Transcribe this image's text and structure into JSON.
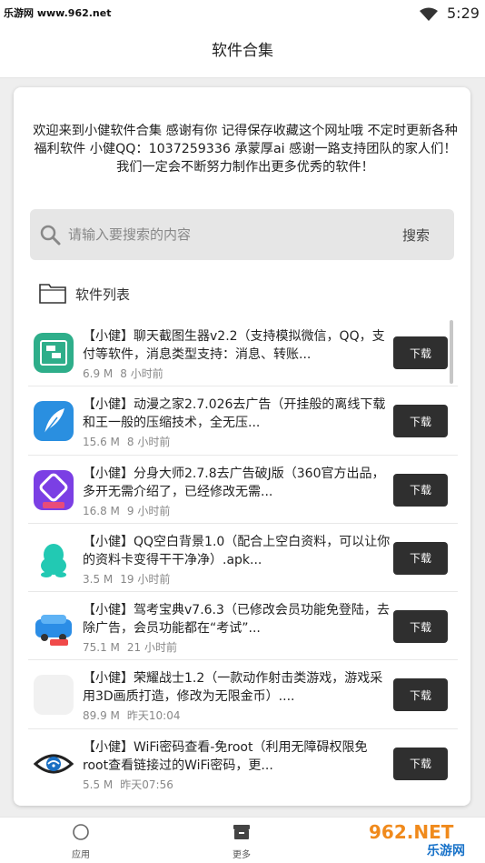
{
  "status_bar": {
    "watermark": "乐游网 www.962.net",
    "time": "5:29"
  },
  "header": {
    "title": "软件合集"
  },
  "intro": {
    "text": "欢迎来到小健软件合集 感谢有你 记得保存收藏这个网址哦 不定时更新各种福利软件 小健QQ：1037259336 承蒙厚ai 感谢一路支持团队的家人们！我们一定会不断努力制作出更多优秀的软件！"
  },
  "search": {
    "placeholder": "请输入要搜索的内容",
    "value": "",
    "button_label": "搜索"
  },
  "section": {
    "label": "软件列表",
    "icon": "folder-icon"
  },
  "apps": [
    {
      "title": "【小健】聊天截图生器v2.2（支持模拟微信，QQ，支付等软件，消息类型支持：消息、转账...",
      "size": "6.9 M",
      "time": "8 小时前",
      "button": "下载",
      "icon": "chat-screenshot-icon",
      "color": "#2eae8a"
    },
    {
      "title": "【小健】动漫之家2.7.026去广告（开挂般的离线下载和王一般的压缩技术，全无压...",
      "size": "15.6 M",
      "time": "8 小时前",
      "button": "下载",
      "icon": "feather-icon",
      "color": "#2a8fe0"
    },
    {
      "title": "【小健】分身大师2.7.8去广告破J版（360官方出品，多开无需介绍了，已经修改无需...",
      "size": "16.8 M",
      "time": "9 小时前",
      "button": "下载",
      "icon": "clone-master-icon",
      "color": "#7b3fe4"
    },
    {
      "title": "【小健】QQ空白背景1.0（配合上空白资料，可以让你的资料卡变得干干净净）.apk...",
      "size": "3.5 M",
      "time": "19 小时前",
      "button": "下载",
      "icon": "penguin-icon",
      "color": "#22c9b3"
    },
    {
      "title": "【小健】驾考宝典v7.6.3（已修改会员功能免登陆，去除广告，会员功能都在“考试”...",
      "size": "75.1 M",
      "time": "21 小时前",
      "button": "下载",
      "icon": "car-icon",
      "color": "#2b8de6"
    },
    {
      "title": "【小健】荣耀战士1.2（一款动作射击类游戏，游戏采用3D画质打造，修改为无限金币）....",
      "size": "89.9 M",
      "time": "昨天10:04",
      "button": "下载",
      "icon": "blank-app-icon",
      "color": "#f1f1f1"
    },
    {
      "title": "【小健】WiFi密码查看-免root（利用无障碍权限免root查看链接过的WiFi密码，更...",
      "size": "5.5 M",
      "time": "昨天07:56",
      "button": "下载",
      "icon": "wifi-eye-icon",
      "color": "#ffffff"
    }
  ],
  "bottom_nav": {
    "items": [
      {
        "label": "应用",
        "icon": "circle-icon"
      },
      {
        "label": "更多",
        "icon": "box-icon"
      }
    ]
  },
  "watermark_logo": {
    "top": "962.NET",
    "bottom": "乐游网"
  }
}
